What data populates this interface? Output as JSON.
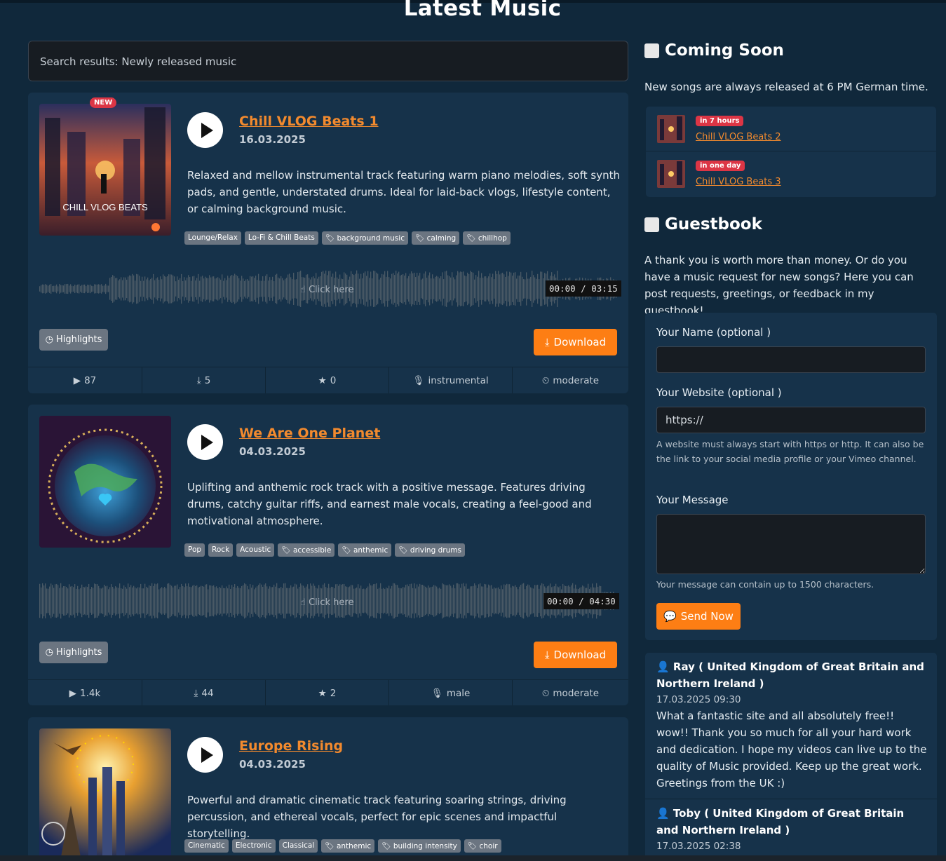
{
  "page_title": "Latest Music",
  "search": {
    "text": "Search results: Newly released music"
  },
  "tracks": [
    {
      "new_badge": "NEW",
      "cover_text": "CHILL VLOG BEATS",
      "title": "Chill VLOG Beats 1",
      "date": "16.03.2025",
      "description": "Relaxed and mellow instrumental track featuring warm piano melodies, soft synth pads, and gentle, understated drums. Ideal for laid-back vlogs, lifestyle content, or calming background music.",
      "tags": [
        "Lounge/Relax",
        "Lo-Fi & Chill Beats",
        "background music",
        "calming",
        "chillhop"
      ],
      "tag_icons": [
        false,
        false,
        true,
        true,
        true
      ],
      "click_here": "Click here",
      "time": "00:00  /  03:15",
      "highlights_label": "Highlights",
      "download_label": "Download",
      "stats": {
        "plays": "87",
        "downloads": "5",
        "favorites": "0",
        "vocals": "instrumental",
        "tempo": "moderate"
      }
    },
    {
      "title": "We Are One Planet",
      "date": "04.03.2025",
      "description": "Uplifting and anthemic rock track with a positive message. Features driving drums, catchy guitar riffs, and earnest male vocals, creating a feel-good and motivational atmosphere.",
      "tags": [
        "Pop",
        "Rock",
        "Acoustic",
        "accessible",
        "anthemic",
        "driving drums"
      ],
      "tag_icons": [
        false,
        false,
        false,
        true,
        true,
        true
      ],
      "click_here": "Click here",
      "time": "00:00  /  04:30",
      "highlights_label": "Highlights",
      "download_label": "Download",
      "stats": {
        "plays": "1.4k",
        "downloads": "44",
        "favorites": "2",
        "vocals": "male",
        "tempo": "moderate"
      }
    },
    {
      "title": "Europe Rising",
      "date": "04.03.2025",
      "description": "Powerful and dramatic cinematic track featuring soaring strings, driving percussion, and ethereal vocals, perfect for epic scenes and impactful storytelling.",
      "tags": [
        "Cinematic",
        "Electronic",
        "Classical",
        "anthemic",
        "building intensity",
        "choir"
      ],
      "tag_icons": [
        false,
        false,
        false,
        true,
        true,
        true
      ]
    }
  ],
  "coming_soon": {
    "heading": "Coming Soon",
    "note": "New songs are always released at 6 PM German time.",
    "items": [
      {
        "badge": "in 7 hours",
        "title": "Chill VLOG Beats 2"
      },
      {
        "badge": "in one day",
        "title": "Chill VLOG Beats 3"
      }
    ]
  },
  "guestbook": {
    "heading": "Guestbook",
    "intro": "A thank you is worth more than money. Or do you have a music request for new songs? Here you can post requests, greetings, or feedback in my guestbook!",
    "form": {
      "name_label": "Your Name (optional )",
      "name_value": "",
      "website_label": "Your Website (optional )",
      "website_value": "https://",
      "website_help": "A website must always start with https or http. It can also be the link to your social media profile or your Vimeo channel.",
      "message_label": "Your Message",
      "message_value": "",
      "message_help": "Your message can contain up to 1500 characters.",
      "send_label": "Send Now"
    },
    "entries": [
      {
        "name": "Ray ( United Kingdom of Great Britain and Northern Ireland )",
        "date": "17.03.2025 09:30",
        "message": "What a fantastic site and all absolutely free!! wow!! Thank you so much for all your hard work and dedication. I hope my videos can live up to the quality of Music provided. Keep up the great work. Greetings from the UK :)"
      },
      {
        "name": "Toby ( United Kingdom of Great Britain and Northern Ireland )",
        "date": "17.03.2025 02:38"
      }
    ]
  },
  "colors": {
    "accent": "#fd7e14",
    "link": "#f28a2e",
    "badge": "#dc3545",
    "card": "#16324a",
    "background": "#10283b"
  }
}
